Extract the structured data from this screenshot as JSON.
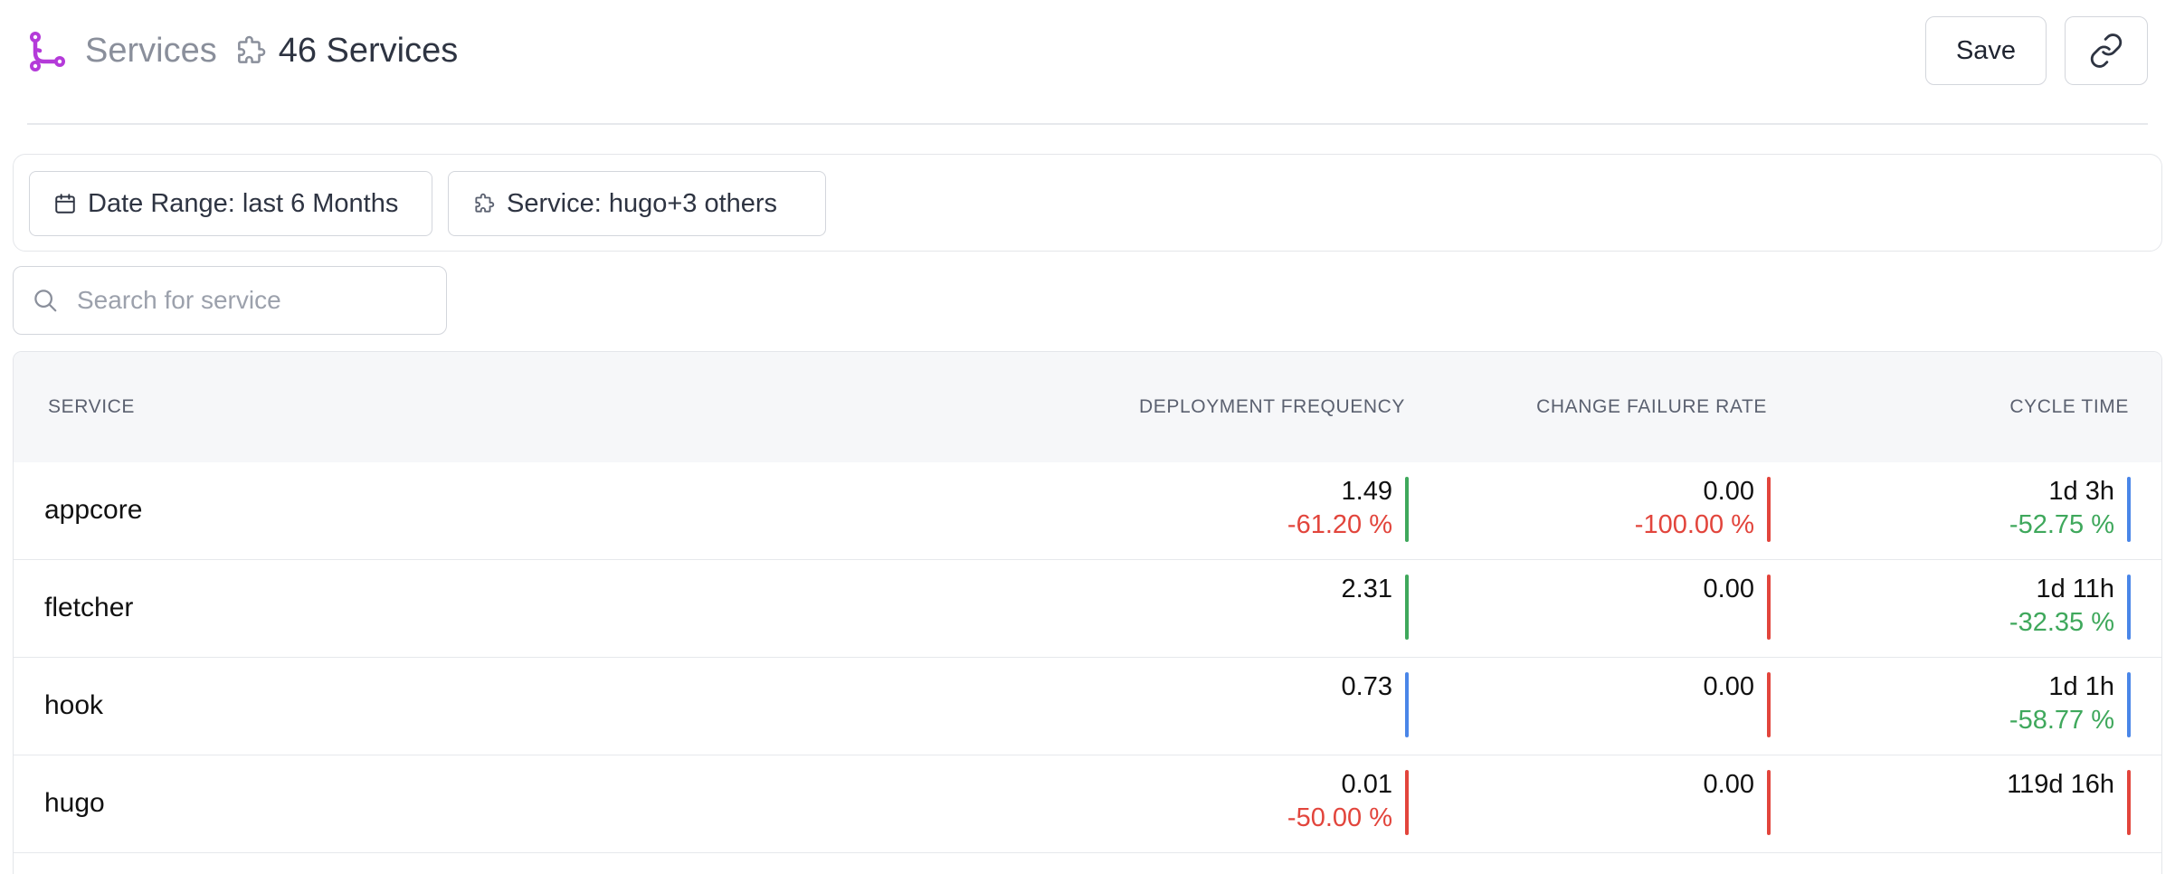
{
  "header": {
    "title": "Services",
    "count_label": "46 Services",
    "save_label": "Save",
    "logo_color": "#b43ad9"
  },
  "filters": {
    "date_range": "Date Range: last 6 Months",
    "service": "Service: hugo+3 others"
  },
  "search": {
    "placeholder": "Search for service",
    "value": ""
  },
  "table": {
    "columns": [
      "SERVICE",
      "DEPLOYMENT FREQUENCY",
      "CHANGE FAILURE RATE",
      "CYCLE TIME"
    ],
    "rows": [
      {
        "service": "appcore",
        "deploy": {
          "value": "1.49",
          "change": "-61.20 %",
          "change_tone": "negative",
          "indicator": "#3fa85c"
        },
        "cfr": {
          "value": "0.00",
          "change": "-100.00 %",
          "change_tone": "negative",
          "indicator": "#e2453c"
        },
        "cycle": {
          "value": "1d 3h",
          "change": "-52.75 %",
          "change_tone": "positive",
          "indicator": "#4a86e8"
        }
      },
      {
        "service": "fletcher",
        "deploy": {
          "value": "2.31",
          "change": "",
          "change_tone": "",
          "indicator": "#3fa85c"
        },
        "cfr": {
          "value": "0.00",
          "change": "",
          "change_tone": "",
          "indicator": "#e2453c"
        },
        "cycle": {
          "value": "1d 11h",
          "change": "-32.35 %",
          "change_tone": "positive",
          "indicator": "#4a86e8"
        }
      },
      {
        "service": "hook",
        "deploy": {
          "value": "0.73",
          "change": "",
          "change_tone": "",
          "indicator": "#4a86e8"
        },
        "cfr": {
          "value": "0.00",
          "change": "",
          "change_tone": "",
          "indicator": "#e2453c"
        },
        "cycle": {
          "value": "1d 1h",
          "change": "-58.77 %",
          "change_tone": "positive",
          "indicator": "#4a86e8"
        }
      },
      {
        "service": "hugo",
        "deploy": {
          "value": "0.01",
          "change": "-50.00 %",
          "change_tone": "negative",
          "indicator": "#e2453c"
        },
        "cfr": {
          "value": "0.00",
          "change": "",
          "change_tone": "",
          "indicator": "#e2453c"
        },
        "cycle": {
          "value": "119d 16h",
          "change": "",
          "change_tone": "",
          "indicator": "#e2453c"
        }
      }
    ]
  }
}
